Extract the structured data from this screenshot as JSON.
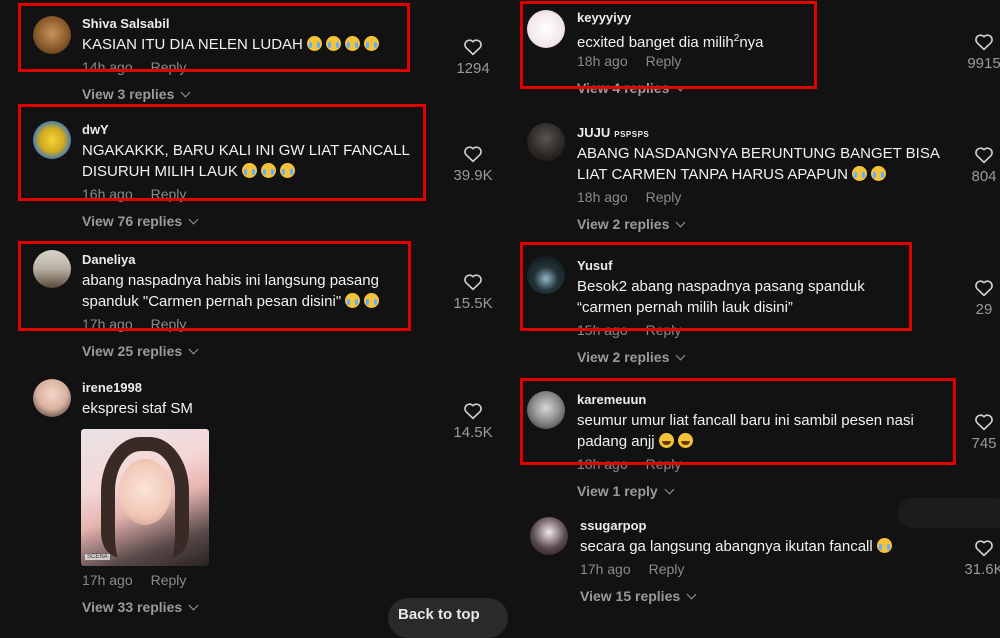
{
  "left": [
    {
      "user": "Shiva Salsabil",
      "lines": [
        "KASIAN ITU DIA NELEN LUDAH"
      ],
      "emoji": "cry",
      "emoji_count": 4,
      "time": "14h ago",
      "reply": "Reply",
      "view": "View 3 replies",
      "likes": "1294"
    },
    {
      "user": "dwY",
      "lines": [
        "NGAKAKKK, BARU KALI INI GW LIAT FANCALL",
        "DISURUH MILIH LAUK"
      ],
      "emoji": "cry",
      "emoji_count": 3,
      "time": "16h ago",
      "reply": "Reply",
      "view": "View 76 replies",
      "likes": "39.9K"
    },
    {
      "user": "Daneliya",
      "lines": [
        "abang naspadnya habis ini langsung pasang",
        "spanduk \"Carmen pernah pesan disini\""
      ],
      "emoji": "cry",
      "emoji_count": 2,
      "time": "17h ago",
      "reply": "Reply",
      "view": "View 25 replies",
      "likes": "15.5K"
    },
    {
      "user": "irene1998",
      "lines": [
        "ekspresi staf SM"
      ],
      "emoji": "",
      "emoji_count": 0,
      "time": "17h ago",
      "reply": "Reply",
      "view": "View 33 replies",
      "likes": "14.5K"
    }
  ],
  "right": [
    {
      "user": "keyyyiyy",
      "line_pre": "ecxited banget dia milih",
      "sup": "2",
      "line_post": "nya",
      "time": "18h ago",
      "reply": "Reply",
      "view": "View 4 replies",
      "likes": "9915"
    },
    {
      "user": "JUJU",
      "user_badge": "PSPSPS",
      "lines": [
        "ABANG NASDANGNYA BERUNTUNG BANGET BISA",
        "LIAT CARMEN TANPA HARUS APAPUN"
      ],
      "emoji": "cry",
      "emoji_count": 2,
      "time": "18h ago",
      "reply": "Reply",
      "view": "View 2 replies",
      "likes": "804"
    },
    {
      "user": "Yusuf",
      "lines": [
        "Besok2 abang naspadnya pasang spanduk",
        "“carmen pernah milih lauk disini”"
      ],
      "emoji": "",
      "emoji_count": 0,
      "time": "15h ago",
      "reply": "Reply",
      "view": "View 2 replies",
      "likes": "29"
    },
    {
      "user": "karemeuun",
      "lines": [
        "seumur umur liat fancall baru ini sambil pesen nasi",
        "padang anjj"
      ],
      "emoji": "laugh",
      "emoji_count": 2,
      "time": "18h ago",
      "reply": "Reply",
      "view": "View 1 reply",
      "likes": "745"
    },
    {
      "user": "ssugarpop",
      "lines": [
        "secara ga langsung abangnya ikutan fancall"
      ],
      "emoji": "cry",
      "emoji_count": 1,
      "time": "17h ago",
      "reply": "Reply",
      "view": "View 15 replies",
      "likes": "31.6K"
    }
  ],
  "back_to_top": "Back to top",
  "photo_caption": "SCENA",
  "colors": {
    "highlight": "#e10000",
    "background": "#121212"
  }
}
